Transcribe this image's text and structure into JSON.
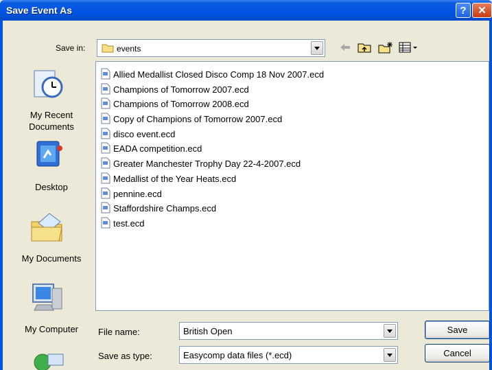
{
  "window": {
    "title": "Save Event As",
    "help": "?",
    "close": "✕"
  },
  "save_in": {
    "label": "Save in:",
    "value": "events"
  },
  "toolbar": {
    "back_icon": "back-arrow-icon",
    "up_icon": "up-folder-icon",
    "new_folder_icon": "new-folder-icon",
    "views_icon": "views-menu-icon"
  },
  "places": [
    {
      "label_lines": [
        "My Recent",
        "Documents"
      ],
      "icon": "recent-documents-icon"
    },
    {
      "label_lines": [
        "Desktop"
      ],
      "icon": "desktop-icon"
    },
    {
      "label_lines": [
        "My Documents"
      ],
      "icon": "my-documents-icon"
    },
    {
      "label_lines": [
        "My Computer"
      ],
      "icon": "my-computer-icon"
    },
    {
      "label_lines": [],
      "icon": "my-network-places-icon"
    }
  ],
  "files": [
    "Allied Medallist Closed Disco Comp 18 Nov 2007.ecd",
    "Champions of Tomorrow 2007.ecd",
    "Champions of Tomorrow 2008.ecd",
    "Copy of Champions of Tomorrow 2007.ecd",
    "disco event.ecd",
    "EADA competition.ecd",
    "Greater Manchester Trophy Day 22-4-2007.ecd",
    "Medallist of the Year Heats.ecd",
    "pennine.ecd",
    "Staffordshire Champs.ecd",
    "test.ecd"
  ],
  "file_name": {
    "label": "File name:",
    "value": "British Open"
  },
  "save_as_type": {
    "label": "Save as type:",
    "value": "Easycomp data files (*.ecd)"
  },
  "buttons": {
    "save": "Save",
    "cancel": "Cancel"
  },
  "colors": {
    "titlebar": "#0054E3",
    "dialog_bg": "#ECE9D8",
    "list_bg": "#FFFFFF"
  }
}
